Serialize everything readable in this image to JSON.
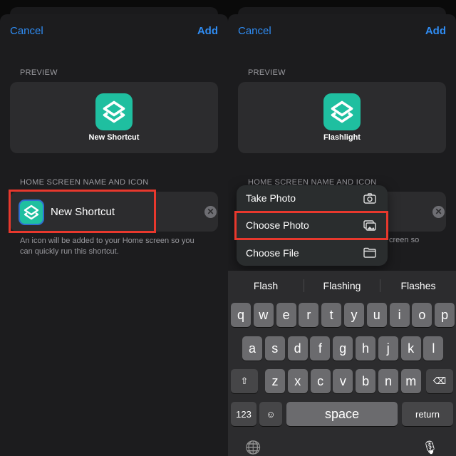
{
  "left": {
    "cancel": "Cancel",
    "add": "Add",
    "preview_label": "PREVIEW",
    "preview_name": "New Shortcut",
    "section_label": "HOME SCREEN NAME AND ICON",
    "name_value": "New Shortcut",
    "note": "An icon will be added to your Home screen so you can quickly run this shortcut.",
    "icon": "shortcuts-layers-icon",
    "clear_icon": "clear-x-icon"
  },
  "right": {
    "cancel": "Cancel",
    "add": "Add",
    "preview_label": "PREVIEW",
    "preview_name": "Flashlight",
    "section_label": "HOME SCREEN NAME AND ICON",
    "note_fragment": "creen so",
    "menu": [
      {
        "label": "Take Photo",
        "icon": "camera-icon"
      },
      {
        "label": "Choose Photo",
        "icon": "photos-icon"
      },
      {
        "label": "Choose File",
        "icon": "folder-icon"
      }
    ],
    "suggestions": [
      "Flash",
      "Flashing",
      "Flashes"
    ],
    "keyboard": {
      "row1": [
        "q",
        "w",
        "e",
        "r",
        "t",
        "y",
        "u",
        "i",
        "o",
        "p"
      ],
      "row2": [
        "a",
        "s",
        "d",
        "f",
        "g",
        "h",
        "j",
        "k",
        "l"
      ],
      "row3": [
        "z",
        "x",
        "c",
        "v",
        "b",
        "n",
        "m"
      ],
      "numbers": "123",
      "space": "space",
      "return": "return",
      "shift": "⇧",
      "delete": "⌫",
      "emoji": "☺",
      "globe": "🌐",
      "mic": "🎙"
    }
  },
  "colors": {
    "accent": "#2f8cf3",
    "icon_bg": "#1fbfa0",
    "highlight": "#e8382d"
  }
}
